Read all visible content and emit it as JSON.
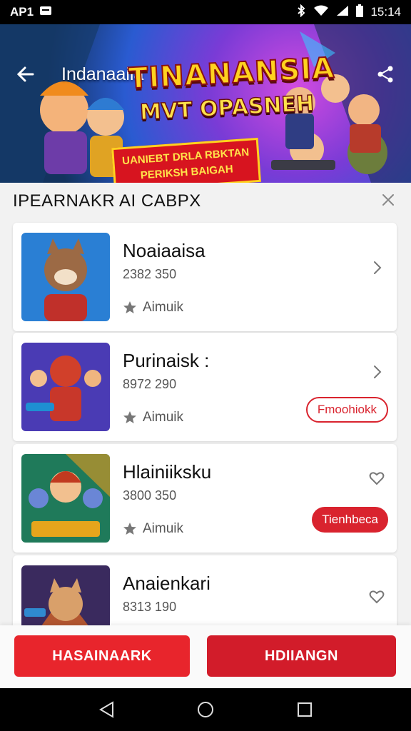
{
  "status_bar": {
    "left_text": "AP1",
    "time": "15:14",
    "icons": [
      "message-icon",
      "bluetooth-icon",
      "wifi-icon",
      "signal-icon",
      "battery-icon"
    ]
  },
  "header": {
    "title": "Indanaaiia",
    "back_icon": "arrow-left-icon",
    "share_icon": "share-icon"
  },
  "banner": {
    "headline": "TINANANSIA",
    "subheadline": "MVT OPASNEH",
    "ribbon_line1": "UANIEBT DRLA RBKTAN",
    "ribbon_line2": "PERIKSH BAIGAH"
  },
  "sheet": {
    "title": "IPEARNAKR AI CABPX",
    "close_icon": "close-icon"
  },
  "items": [
    {
      "title": "Noaiaaisa",
      "meta": "2382 350",
      "rating_label": "Aimuik",
      "action_icon": "chevron-right-icon",
      "pill_label": "",
      "pill_style": ""
    },
    {
      "title": "Purinaisk :",
      "meta": "8972 290",
      "rating_label": "Aimuik",
      "action_icon": "chevron-right-icon",
      "pill_label": "Fmoohiokk",
      "pill_style": "outline"
    },
    {
      "title": "Hlainiiksku",
      "meta": "3800 350",
      "rating_label": "Aimuik",
      "action_icon": "heart-icon",
      "pill_label": "Tienhbeca",
      "pill_style": "filled"
    },
    {
      "title": "Anaienkari",
      "meta": "8313 190",
      "rating_label": "",
      "action_icon": "heart-icon",
      "pill_label": "",
      "pill_style": ""
    }
  ],
  "bottom_buttons": {
    "left_label": "HASAINAARK",
    "right_label": "HDIIANGN"
  },
  "colors": {
    "accent_red": "#d9232e",
    "status_bar": "#000000"
  }
}
